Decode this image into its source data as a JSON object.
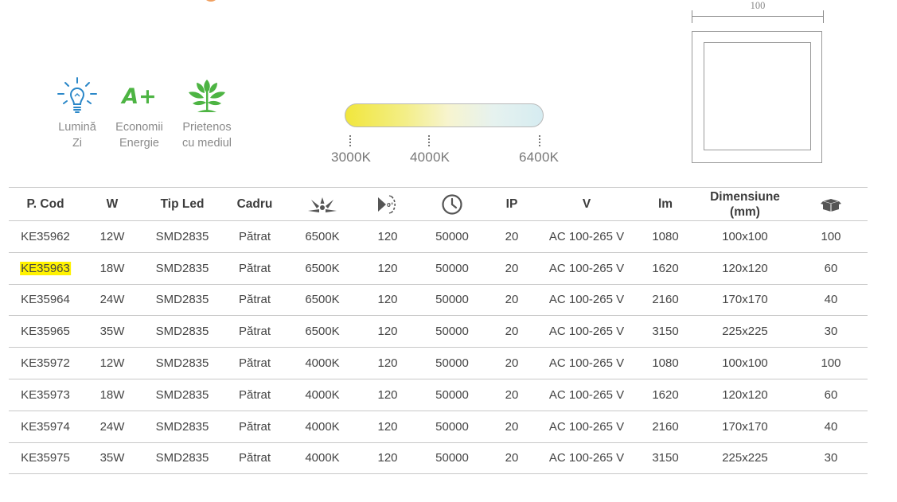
{
  "features": [
    {
      "icon": "light-bulb-icon",
      "label": "Lumină\nZi"
    },
    {
      "icon": "energy-class-icon",
      "text": "A+",
      "label": "Economii\nEnergie"
    },
    {
      "icon": "plant-leaves-icon",
      "label": "Prietenos\ncu mediul"
    }
  ],
  "cct": {
    "labels": [
      "3000K",
      "4000K",
      "6400K"
    ]
  },
  "dimension_drawing": {
    "width_label": "100"
  },
  "table": {
    "headers": [
      "P. Cod",
      "W",
      "Tip Led",
      "Cadru",
      "color-temperature-icon",
      "beam-angle-icon",
      "clock-icon",
      "IP",
      "V",
      "lm",
      "Dimensiune\n(mm)",
      "box-package-icon"
    ],
    "header_text": {
      "code": "P. Cod",
      "watt": "W",
      "led": "Tip Led",
      "frame": "Cadru",
      "ip": "IP",
      "voltage": "V",
      "lumen": "lm",
      "dimension": "Dimensiune",
      "dimension_unit": "(mm)"
    },
    "highlighted_code": "KE35963",
    "highlight_color": "#fff200",
    "rows": [
      [
        "KE35962",
        "12W",
        "SMD2835",
        "Pătrat",
        "6500K",
        "120",
        "50000",
        "20",
        "AC 100-265 V",
        "1080",
        "100x100",
        "100"
      ],
      [
        "KE35963",
        "18W",
        "SMD2835",
        "Pătrat",
        "6500K",
        "120",
        "50000",
        "20",
        "AC 100-265 V",
        "1620",
        "120x120",
        "60"
      ],
      [
        "KE35964",
        "24W",
        "SMD2835",
        "Pătrat",
        "6500K",
        "120",
        "50000",
        "20",
        "AC 100-265 V",
        "2160",
        "170x170",
        "40"
      ],
      [
        "KE35965",
        "35W",
        "SMD2835",
        "Pătrat",
        "6500K",
        "120",
        "50000",
        "20",
        "AC 100-265 V",
        "3150",
        "225x225",
        "30"
      ],
      [
        "KE35972",
        "12W",
        "SMD2835",
        "Pătrat",
        "4000K",
        "120",
        "50000",
        "20",
        "AC 100-265 V",
        "1080",
        "100x100",
        "100"
      ],
      [
        "KE35973",
        "18W",
        "SMD2835",
        "Pătrat",
        "4000K",
        "120",
        "50000",
        "20",
        "AC 100-265 V",
        "1620",
        "120x120",
        "60"
      ],
      [
        "KE35974",
        "24W",
        "SMD2835",
        "Pătrat",
        "4000K",
        "120",
        "50000",
        "20",
        "AC 100-265 V",
        "2160",
        "170x170",
        "40"
      ],
      [
        "KE35975",
        "35W",
        "SMD2835",
        "Pătrat",
        "4000K",
        "120",
        "50000",
        "20",
        "AC 100-265 V",
        "3150",
        "225x225",
        "30"
      ]
    ]
  },
  "colors": {
    "accent_green": "#4db443",
    "icon_blue": "#2a87c8"
  }
}
